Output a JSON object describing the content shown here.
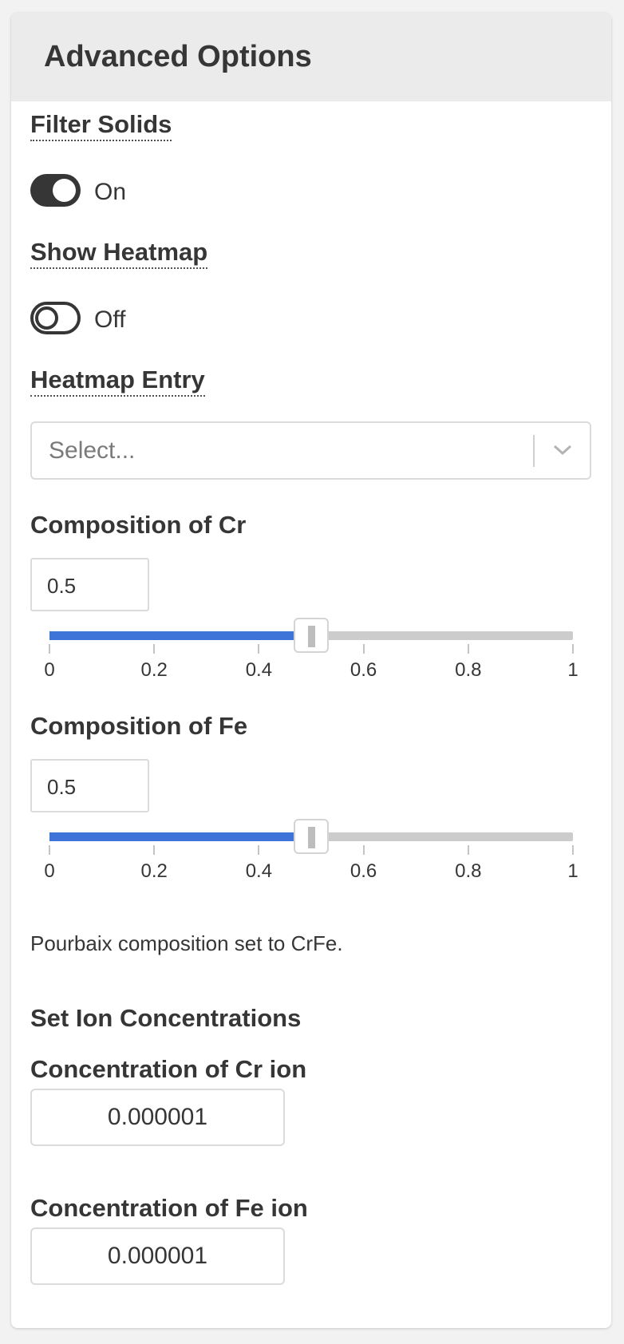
{
  "panel": {
    "title": "Advanced Options"
  },
  "filter_solids": {
    "label": "Filter Solids",
    "state": "On",
    "enabled": true
  },
  "show_heatmap": {
    "label": "Show Heatmap",
    "state": "Off",
    "enabled": false
  },
  "heatmap_entry": {
    "label": "Heatmap Entry",
    "placeholder": "Select...",
    "icon": "chevron-down-icon"
  },
  "composition_cr": {
    "label": "Composition of Cr",
    "value": "0.5",
    "slider_value": 0.5,
    "ticks": [
      "0",
      "0.2",
      "0.4",
      "0.6",
      "0.8",
      "1"
    ]
  },
  "composition_fe": {
    "label": "Composition of Fe",
    "value": "0.5",
    "slider_value": 0.5,
    "ticks": [
      "0",
      "0.2",
      "0.4",
      "0.6",
      "0.8",
      "1"
    ]
  },
  "composition_note": "Pourbaix composition set to CrFe.",
  "ion_section": {
    "heading": "Set Ion Concentrations",
    "cr": {
      "label": "Concentration of Cr ion",
      "value": "0.000001"
    },
    "fe": {
      "label": "Concentration of Fe ion",
      "value": "0.000001"
    }
  },
  "colors": {
    "accent": "#3e73d8",
    "toggle": "#363636",
    "header_bg": "#ebebeb"
  }
}
